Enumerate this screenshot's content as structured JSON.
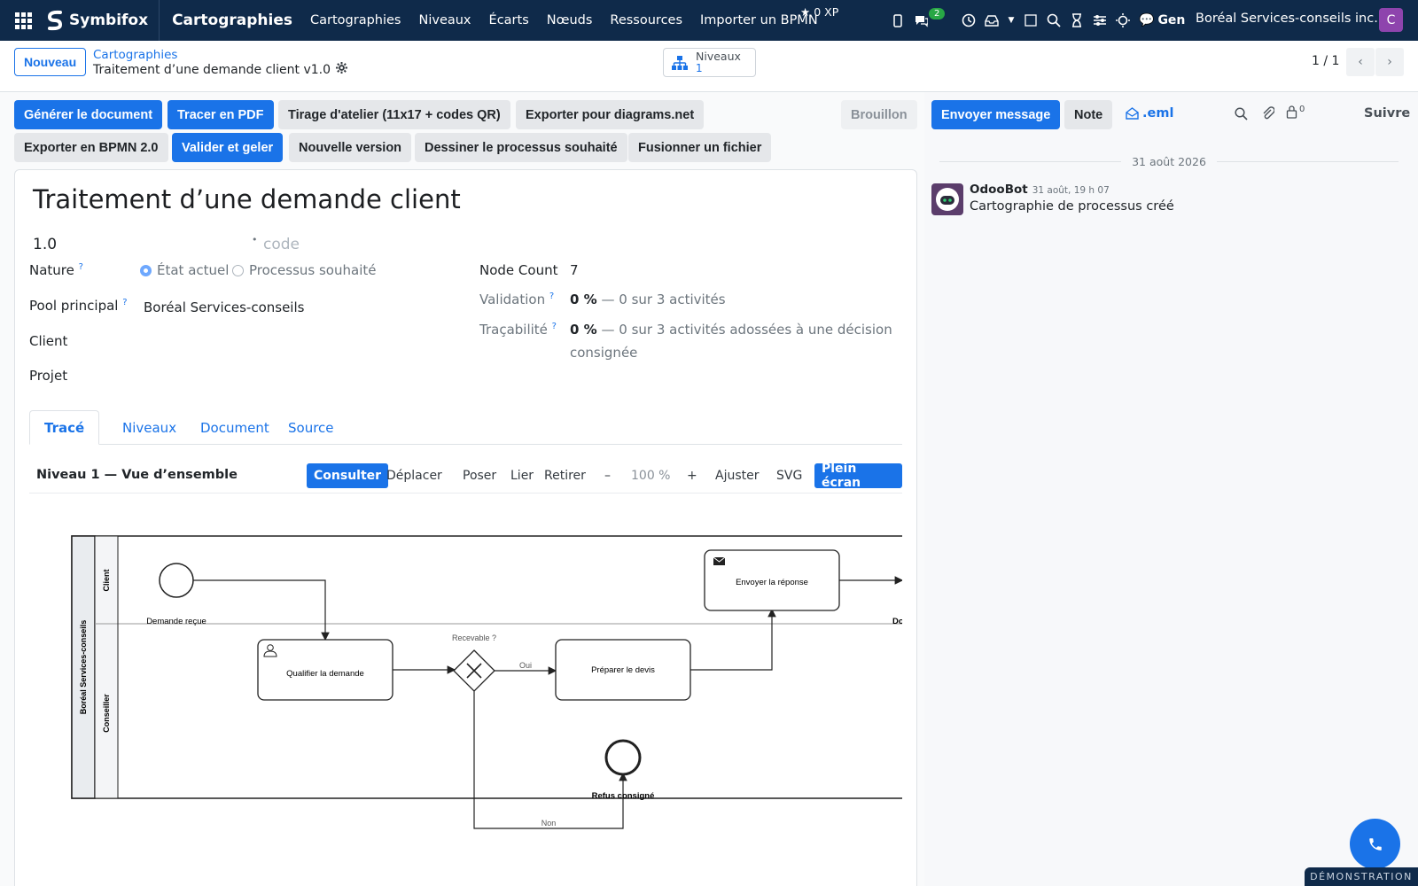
{
  "topbar": {
    "brand": "Symbifox",
    "app_title": "Cartographies",
    "menu": [
      "Cartographies",
      "Niveaux",
      "Écarts",
      "Nœuds",
      "Ressources",
      "Importer un BPMN"
    ],
    "xp": "0 XP",
    "chat_badge": "2",
    "gen": "Gen",
    "company": "Boréal Services-conseils inc.",
    "avatar_letter": "C"
  },
  "control": {
    "new_label": "Nouveau",
    "breadcrumb_parent": "Cartographies",
    "breadcrumb_current": "Traitement d’une demande client v1.0",
    "levels_stat_label": "Niveaux",
    "levels_stat_value": "1",
    "pager": "1 / 1"
  },
  "actions": {
    "generate": "Générer le document",
    "pdf": "Tracer en PDF",
    "print": "Tirage d'atelier (11x17 + codes QR)",
    "export_drawio": "Exporter pour diagrams.net",
    "export_bpmn": "Exporter en BPMN 2.0",
    "validate": "Valider et geler",
    "new_version": "Nouvelle version",
    "draw_target": "Dessiner le processus souhaité",
    "merge": "Fusionner un fichier",
    "status": "Brouillon"
  },
  "form": {
    "title": "Traitement d’une demande client",
    "version": "1.0",
    "code_placeholder": "code",
    "nature_label": "Nature",
    "nature_opt1": "État actuel",
    "nature_opt2": "Processus souhaité",
    "pool_label": "Pool principal",
    "pool_value": "Boréal Services-conseils",
    "client_label": "Client",
    "project_label": "Projet",
    "node_count_label": "Node Count",
    "node_count_value": "7",
    "validation_label": "Validation",
    "validation_pct": "0 %",
    "validation_detail": "— 0 sur 3 activités",
    "trace_label": "Traçabilité",
    "trace_pct": "0 %",
    "trace_detail_1": "— 0 sur 3 activités adossées à une décision",
    "trace_detail_2": "consignée"
  },
  "tabs": [
    "Tracé",
    "Niveaux",
    "Document",
    "Source"
  ],
  "diagram_toolbar": {
    "title": "Niveau 1 — Vue d’ensemble",
    "consult": "Consulter",
    "move": "Déplacer",
    "place": "Poser",
    "link": "Lier",
    "remove": "Retirer",
    "minus": "–",
    "zoom": "100 %",
    "plus": "+",
    "fit": "Ajuster",
    "svg": "SVG",
    "fullscreen": "Plein écran"
  },
  "diagram": {
    "pool": "Boréal Services-conseils",
    "lane_client": "Client",
    "lane_advisor": "Conseiller",
    "start_event": "Demande reçue",
    "task_qualify": "Qualifier la demande",
    "gateway": "Recevable ?",
    "flow_yes": "Oui",
    "flow_no": "Non",
    "task_quote": "Préparer le devis",
    "task_send": "Envoyer la réponse",
    "end_refused": "Refus consigné",
    "end_cut": "Do"
  },
  "chatter": {
    "send_message": "Envoyer message",
    "note": "Note",
    "eml": ".eml",
    "followers": "0",
    "follow": "Suivre",
    "date": "31 août 2026",
    "author": "OdooBot",
    "time": "31 août, 19 h 07",
    "body": "Cartographie de processus créé"
  },
  "footer": {
    "demo": "DÉMONSTRATION"
  }
}
